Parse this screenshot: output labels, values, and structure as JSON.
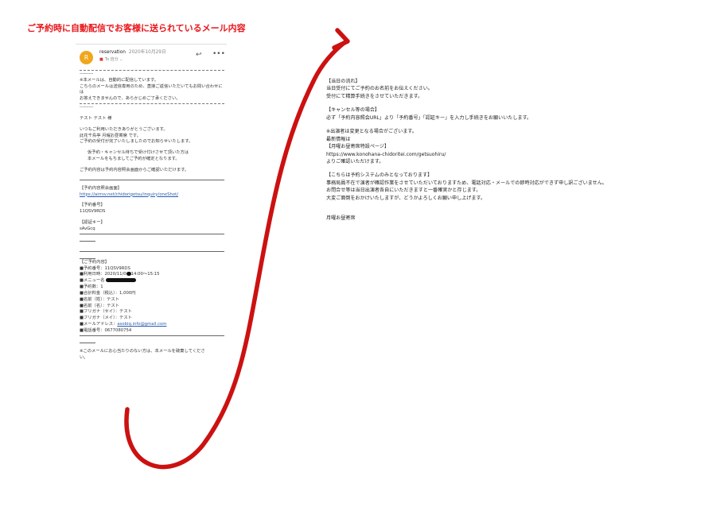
{
  "headline": "ご予約時に自動配信でお客様に送られているメール内容",
  "email": {
    "avatar_letter": "R",
    "sender": "reservation",
    "date": "2020年10月29日",
    "to": "To 自分 ⌄",
    "header_dashes": "---------",
    "notice": [
      "※本メールは、自動的に配信しています。",
      "こちらのメールは送信専用のため、直接ご返信いただいてもお問い合わせには",
      "お答えできませんので、あらかじめご了承ください。"
    ],
    "footer_dashes": "---------",
    "greeting": "テスト テスト 様",
    "intro": [
      "いつもご利用いただきありがとうございます。",
      "此花千鳥亭 月曜お昼寄席 です。",
      "ご予約の受付が完了いたしましたのでお知らせいたします。"
    ],
    "indent": [
      "仮予約・キャンセル待ちで受け付けさせて頂いた方は",
      "本メールをもちましてご予約が確定となります。"
    ],
    "confirm_note": "ご予約内容は予約内容照会画面からご確認いただけます。",
    "inquiry_label": "【予約内容照会画面】",
    "inquiry_url": "https://airrsv.net/chidorigetsu/inquiry/oneShot/",
    "number_label": "【予約番号】",
    "number": "11QSV9RDS",
    "key_label": "【認証キー】",
    "key": "sAvGcq",
    "details_title": "【ご予約内容】",
    "details": {
      "number": "■予約番号：11QSV9RDS",
      "datetime_a": "■利用日時：2020/11/0",
      "datetime_b": "14:00〜15:15",
      "menu": "■メニュー名",
      "count": "■予約数：1",
      "total": "■合計料金（税込）：1,000円",
      "last": "■名前（姓）：テスト",
      "first": "■名前（名）：テスト",
      "kana_sei": "■フリガナ（セイ）：テスト",
      "kana_mei": "■フリガナ（メイ）：テスト",
      "mail_label": "■メールアドレス：",
      "mail_value": "asobiq.info@gmail.com",
      "phone": "■電話番号：0677080754"
    },
    "closing": [
      "※このメールにお心当たりのない方は、本メールを破棄してくださ",
      "い。"
    ]
  },
  "right_text": {
    "day_title": "【当日の流れ】",
    "day_lines": [
      "当日受付にてご予約のお名前をお伝えください。",
      "受付にて精算手続きをさせていただきます。"
    ],
    "cancel_title": "【キャンセル等の場合】",
    "cancel_line": "必ず「予約内容照会URL」より「予約番号」「認証キー」を入力し手続きをお願いいたします。",
    "change_lines": [
      "※出演者は変更となる場合がございます。",
      "最新情報は"
    ],
    "site_title": "【月曜お昼寄席特設ページ】",
    "site_url": "https://www.konohana-chidoritei.com/getsuohiru/",
    "site_note": "よりご確認いただけます。",
    "system_title": "【こちらは予約システムのみとなっております】",
    "system_lines": [
      "事務局員不在で演者が確認作業をさせていただいておりますため、電話対応・メールでの即時対応ができず申し訳ございません。",
      "お問合せ等は当日出演者各自にいただきますと一番確実かと存じます。",
      "大変ご面倒をおかけいたしますが、どうかよろしくお願い申し上げます。"
    ],
    "signature": "月曜お昼寄席"
  },
  "colors": {
    "headline": "#e8161b",
    "arrow": "#cc1111",
    "avatar": "#f0a71a",
    "link": "#2a5db0"
  },
  "icons": [
    "reply-icon",
    "more-icon",
    "lock-icon",
    "curved-arrow"
  ]
}
